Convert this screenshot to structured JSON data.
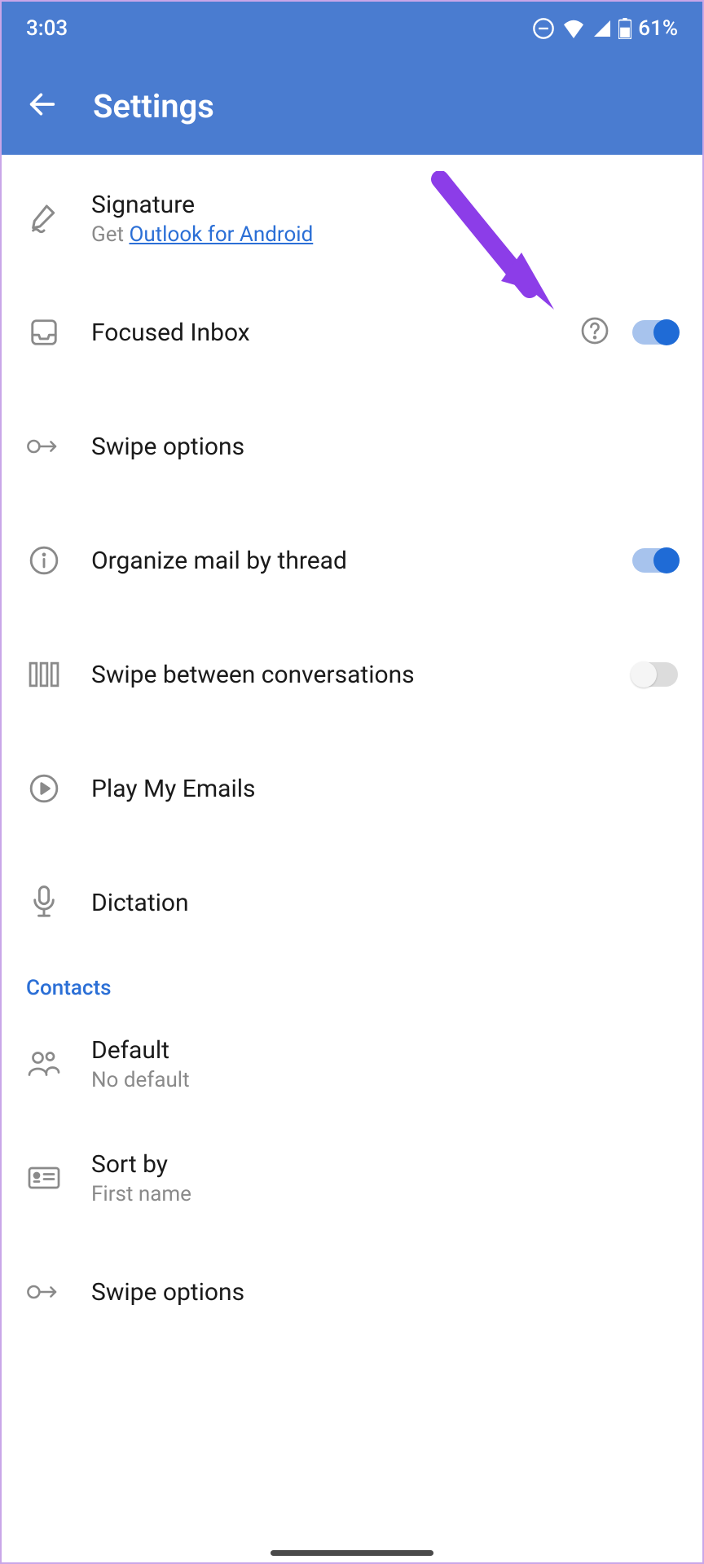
{
  "status": {
    "time": "3:03",
    "battery_pct": "61%"
  },
  "header": {
    "title": "Settings"
  },
  "rows": {
    "signature": {
      "title": "Signature",
      "sub_prefix": "Get ",
      "link_text": "Outlook for Android"
    },
    "focused": {
      "title": "Focused Inbox"
    },
    "swipe1": {
      "title": "Swipe options"
    },
    "organize": {
      "title": "Organize mail by thread"
    },
    "swipebetween": {
      "title": "Swipe between conversations"
    },
    "play": {
      "title": "Play My Emails"
    },
    "dictation": {
      "title": "Dictation"
    },
    "default": {
      "title": "Default",
      "sub": "No default"
    },
    "sortby": {
      "title": "Sort by",
      "sub": "First name"
    },
    "swipe2": {
      "title": "Swipe options"
    }
  },
  "sections": {
    "contacts": "Contacts"
  }
}
